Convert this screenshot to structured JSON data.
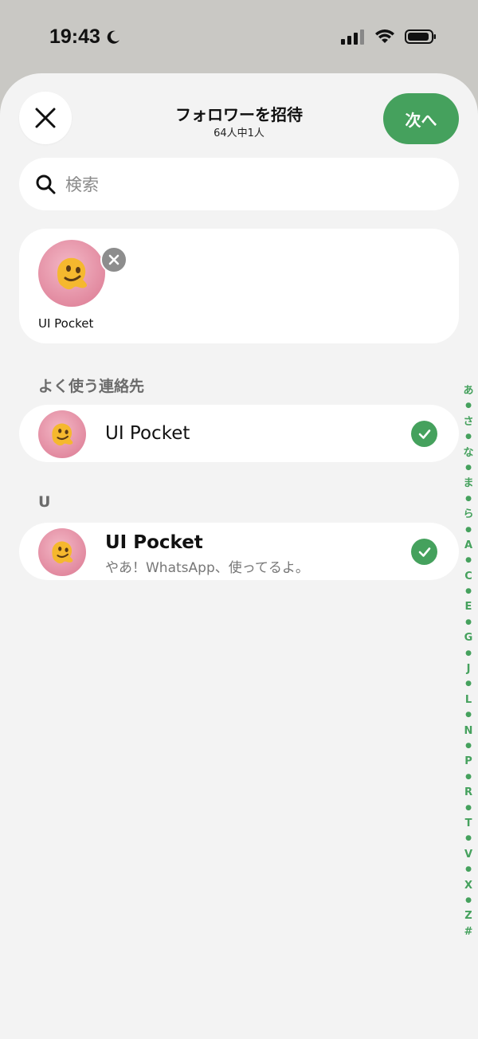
{
  "status": {
    "time": "19:43"
  },
  "header": {
    "title": "フォロワーを招待",
    "subtitle": "64人中1人",
    "next_label": "次へ"
  },
  "search": {
    "placeholder": "検索"
  },
  "selected": [
    {
      "name": "UI Pocket"
    }
  ],
  "sections": [
    {
      "title": "よく使う連絡先",
      "contacts": [
        {
          "name": "UI Pocket",
          "checked": true
        }
      ]
    },
    {
      "title": "U",
      "contacts": [
        {
          "name": "UI Pocket",
          "status": "やあ！WhatsApp、使ってるよ。",
          "checked": true
        }
      ]
    }
  ],
  "alpha_index": [
    "あ",
    "●",
    "さ",
    "●",
    "な",
    "●",
    "ま",
    "●",
    "ら",
    "●",
    "A",
    "●",
    "C",
    "●",
    "E",
    "●",
    "G",
    "●",
    "J",
    "●",
    "L",
    "●",
    "N",
    "●",
    "P",
    "●",
    "R",
    "●",
    "T",
    "●",
    "V",
    "●",
    "X",
    "●",
    "Z",
    "#"
  ],
  "colors": {
    "accent": "#45a15d",
    "sheet": "#f3f3f3",
    "avatar": "#e28aa0"
  }
}
